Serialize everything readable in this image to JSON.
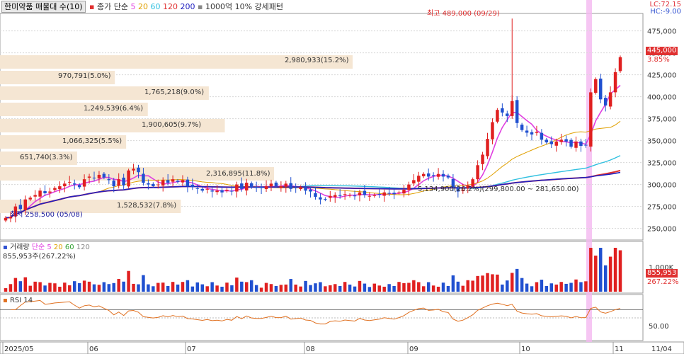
{
  "header": {
    "title": "한미약품 매물대 수(10)",
    "ma_label": "종가 단순",
    "ma_periods": [
      "5",
      "20",
      "60",
      "120",
      "200"
    ],
    "ma_colors": [
      "#e040e0",
      "#e0a000",
      "#30c0e0",
      "#e03030",
      "#2020c0"
    ],
    "pattern_label": "1000억 10% 강세패턴",
    "lc": "LC:72.15",
    "hc": "HC:-9.00"
  },
  "price_panel": {
    "high_annotation": "최고 489,000 (09/29)",
    "low_annotation": "최저 258,500 (05/08)",
    "current_price": "445,000",
    "current_change": "3.85%",
    "range_annotation": "5,134,900(26.2%)(299,800.00 ~ 281,650.00)",
    "y_ticks": [
      "475,000",
      "450,000",
      "425,000",
      "400,000",
      "375,000",
      "350,000",
      "325,000",
      "300,000",
      "275,000",
      "250,000"
    ]
  },
  "volume_profile": [
    {
      "label": "2,980,933(15.2%)"
    },
    {
      "label": "970,791(5.0%)"
    },
    {
      "label": "1,765,218(9.0%)"
    },
    {
      "label": "1,249,539(6.4%)"
    },
    {
      "label": "1,900,605(9.7%)"
    },
    {
      "label": "1,066,325(5.5%)"
    },
    {
      "label": "651,740(3.3%)"
    },
    {
      "label": "2,316,895(11.8%)"
    },
    {
      "label": "1,528,532(7.8%)"
    }
  ],
  "volume_panel": {
    "title": "거래량",
    "ma_label": "단순",
    "ma_periods": [
      "5",
      "20",
      "60",
      "120"
    ],
    "ma_colors": [
      "#e040e0",
      "#e0a000",
      "#30a030",
      "#888888"
    ],
    "value_label": "855,953주(267.22%)",
    "y_tick": "1,000K",
    "current_volume": "855,953",
    "current_ratio": "267.22%"
  },
  "rsi_panel": {
    "title": "RSI 14",
    "y_tick": "50.00"
  },
  "x_axis": {
    "labels": [
      "2025/05",
      "06",
      "07",
      "08",
      "09",
      "10",
      "11",
      "11/04"
    ]
  },
  "chart_data": {
    "type": "candlestick",
    "title": "한미약품",
    "x_labels": [
      "2025/05",
      "06",
      "07",
      "08",
      "09",
      "10",
      "11"
    ],
    "ylim": [
      240000,
      490000
    ],
    "price_series_close": [
      262000,
      263000,
      275000,
      272000,
      283000,
      285000,
      288000,
      293000,
      290000,
      292000,
      296000,
      298000,
      301000,
      303000,
      300000,
      297000,
      306000,
      309000,
      307000,
      311000,
      308000,
      305000,
      298000,
      306000,
      299000,
      316000,
      318000,
      314000,
      302000,
      300000,
      298000,
      300000,
      305000,
      302000,
      306000,
      303000,
      305000,
      298000,
      297000,
      295000,
      293000,
      295000,
      292000,
      293000,
      291000,
      294000,
      292000,
      300000,
      295000,
      302000,
      297000,
      296000,
      296000,
      298000,
      301000,
      298000,
      298000,
      301000,
      295000,
      296000,
      297000,
      293000,
      292000,
      286000,
      283000,
      283000,
      287000,
      288000,
      287000,
      289000,
      288000,
      287000,
      291000,
      288000,
      287000,
      288000,
      289000,
      291000,
      290000,
      289000,
      291000,
      294000,
      300000,
      305000,
      310000,
      312000,
      309000,
      310000,
      312000,
      309000,
      308000,
      297000,
      292000,
      294000,
      299000,
      306000,
      322000,
      334000,
      352000,
      371000,
      385000,
      382000,
      378000,
      395000,
      370000,
      362000,
      359000,
      357000,
      360000,
      351000,
      348000,
      346000,
      349000,
      351000,
      349000,
      343000,
      349000,
      344000,
      345000,
      405000,
      420000,
      397000,
      390000,
      405000,
      428000,
      445000
    ],
    "ma5_color": "#e040e0",
    "ma20_color": "#e0a000",
    "ma60_color": "#30c0e0",
    "ma120_color": "#e03030",
    "ma200_color": "#2020c0",
    "volume_profile_values": [
      2980933,
      970791,
      1765218,
      1249539,
      1900605,
      1066325,
      651740,
      2316895,
      1528532
    ],
    "volume_profile_pct": [
      15.2,
      5.0,
      9.0,
      6.4,
      9.7,
      5.5,
      3.3,
      11.8,
      7.8
    ],
    "high": 489000,
    "low": 258500,
    "last": 445000,
    "last_change_pct": 3.85,
    "rsi_ref": 50.0
  }
}
